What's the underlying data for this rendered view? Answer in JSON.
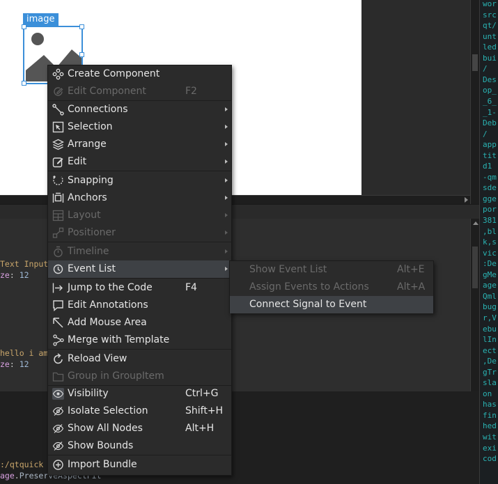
{
  "canvas": {
    "selected_item_label": "image"
  },
  "code_lines": [
    {
      "str": "Text Input",
      "prop": "ze",
      "num": "12"
    },
    {
      "str": "hello i am",
      "prop": "ze",
      "num": "12"
    }
  ],
  "output_lines": [
    {
      "text": ":/qtquick"
    },
    {
      "obj": "age",
      "prop": "PreserveAspectFit"
    }
  ],
  "log_lines": [
    "wor",
    "src",
    "qt/",
    "unt",
    "led",
    "bui",
    "/",
    "Des",
    "op_",
    "_6_",
    "_1-",
    "Deb",
    "/",
    "app",
    "tit",
    "d1",
    "-qm",
    "sde",
    "gge",
    "por",
    "381",
    ",bl",
    "k,s",
    "vic",
    ":De",
    "gMe",
    "age",
    "Qml",
    "bug",
    "r,V",
    "ebu",
    "lIn",
    "ect",
    ",De",
    "gTr",
    "sla",
    "on",
    "has",
    "fin",
    "hed",
    "wit",
    "exi",
    "cod"
  ],
  "context_menu": {
    "items": [
      {
        "label": "Create Component",
        "icon": "component-icon",
        "enabled": true
      },
      {
        "label": "Edit Component",
        "icon": "edit-component-icon",
        "shortcut": "F2",
        "enabled": false
      },
      {
        "label": "Connections",
        "icon": "connections-icon",
        "submenu": true,
        "enabled": true
      },
      {
        "label": "Selection",
        "icon": "selection-icon",
        "submenu": true,
        "enabled": true
      },
      {
        "label": "Arrange",
        "icon": "arrange-icon",
        "submenu": true,
        "enabled": true
      },
      {
        "label": "Edit",
        "icon": "edit-icon",
        "submenu": true,
        "enabled": true
      },
      {
        "label": "Snapping",
        "icon": "snapping-icon",
        "submenu": true,
        "enabled": true
      },
      {
        "label": "Anchors",
        "icon": "anchors-icon",
        "submenu": true,
        "enabled": true
      },
      {
        "label": "Layout",
        "icon": "layout-icon",
        "submenu": true,
        "enabled": false
      },
      {
        "label": "Positioner",
        "icon": "positioner-icon",
        "submenu": true,
        "enabled": false
      },
      {
        "label": "Timeline",
        "icon": "timeline-icon",
        "submenu": true,
        "enabled": false
      },
      {
        "label": "Event List",
        "icon": "event-list-icon",
        "submenu": true,
        "enabled": true
      },
      {
        "label": "Jump to the Code",
        "icon": "jump-to-code-icon",
        "shortcut": "F4",
        "enabled": true
      },
      {
        "label": "Edit Annotations",
        "icon": "annotation-icon",
        "enabled": true
      },
      {
        "label": "Add Mouse Area",
        "icon": "mouse-area-icon",
        "enabled": true
      },
      {
        "label": "Merge with Template",
        "icon": "merge-icon",
        "enabled": true
      },
      {
        "label": "Reload View",
        "icon": "reload-icon",
        "enabled": true
      },
      {
        "label": "Group in GroupItem",
        "icon": "group-icon",
        "enabled": false
      },
      {
        "label": "Visibility",
        "icon": "eye-icon",
        "shortcut": "Ctrl+G",
        "enabled": true,
        "checked": true
      },
      {
        "label": "Isolate Selection",
        "icon": "eye-hidden-icon",
        "shortcut": "Shift+H",
        "enabled": true
      },
      {
        "label": "Show All Nodes",
        "icon": "eye-hidden-icon",
        "shortcut": "Alt+H",
        "enabled": true
      },
      {
        "label": "Show Bounds",
        "icon": "eye-hidden-icon",
        "enabled": true
      },
      {
        "label": "Import Bundle",
        "icon": "import-bundle-icon",
        "enabled": true
      }
    ]
  },
  "event_list_submenu": {
    "items": [
      {
        "label": "Show Event List",
        "shortcut": "Alt+E",
        "enabled": false
      },
      {
        "label": "Assign Events to Actions",
        "shortcut": "Alt+A",
        "enabled": false
      },
      {
        "label": "Connect Signal to Event",
        "enabled": true
      }
    ]
  },
  "colors": {
    "accent": "#3b8fd9",
    "log_text": "#2ab3b3",
    "menu_bg": "#2b2b2b",
    "menu_highlight": "#3e4145"
  }
}
